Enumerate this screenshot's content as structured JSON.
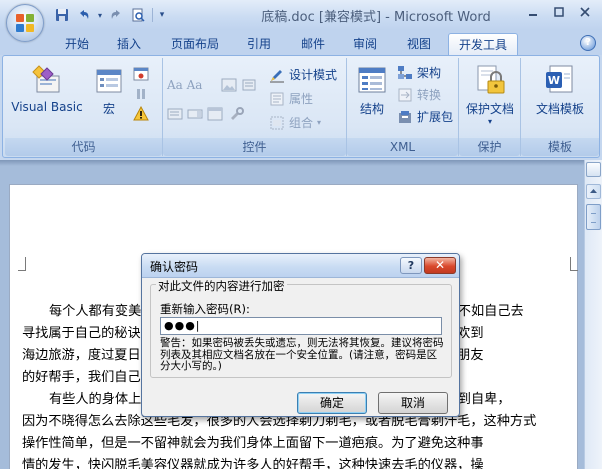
{
  "window": {
    "title": "底稿.doc [兼容模式] - Microsoft Word"
  },
  "qat": {
    "save": "save-icon",
    "undo": "undo-icon",
    "redo": "redo-icon",
    "preview": "print-preview-icon",
    "more": "▾"
  },
  "tabs": [
    "开始",
    "插入",
    "页面布局",
    "引用",
    "邮件",
    "审阅",
    "视图",
    "开发工具"
  ],
  "active_tab": "开发工具",
  "ribbon": {
    "code": {
      "title": "代码",
      "visual_basic": "Visual Basic",
      "macro": "宏"
    },
    "controls": {
      "title": "控件",
      "design_mode": "设计模式",
      "properties": "属性",
      "group": "组合"
    },
    "xml": {
      "title": "XML",
      "structure": "结构",
      "schema": "架构",
      "transform": "转换",
      "expansion_pack": "扩展包"
    },
    "protect": {
      "title": "保护",
      "protect_document": "保护文档"
    },
    "templates": {
      "title": "模板",
      "document_template": "文档模板"
    }
  },
  "document": {
    "lines": [
      "每个人都有变美的权利，也有变美的秘诀。对于那些追求美丽的秘诀，不如自己去",
      "寻找属于自己的秘诀。随着天气的逐渐变热，越来越多的人，有一些女性喜欢到",
      "海边旅游，度过夏日时光。这个时候脱毛就显得十分重要，脱毛就成为女性朋友",
      "的好帮手，我们自己也可以脱毛。",
      "有些人的身体上会长很多的毛发，会让自己非常的苦恼，也会明显感觉到自卑，",
      "因为不晓得怎么去除这些毛发，很多的人会选择剃刀剃毛，或者脱毛膏剃汗毛，这种方式",
      "操作性简单，但是一不留神就会为我们身体上面留下一道疤痕。为了避免这种事",
      "情的发生，快闪脱毛美容仪器就成为许多人的好帮手，这种快速去毛的仪器，操"
    ]
  },
  "dialog": {
    "title": "确认密码",
    "help": "?",
    "close": "✕",
    "section": "对此文件的内容进行加密",
    "label": "重新输入密码(R):",
    "password_value": "●●●|",
    "warning": "警告：如果密码被丢失或遗忘，则无法将其恢复。建议将密码列表及其相应文档名放在一个安全位置。(请注意，密码是区分大小写的。)",
    "ok": "确定",
    "cancel": "取消"
  }
}
